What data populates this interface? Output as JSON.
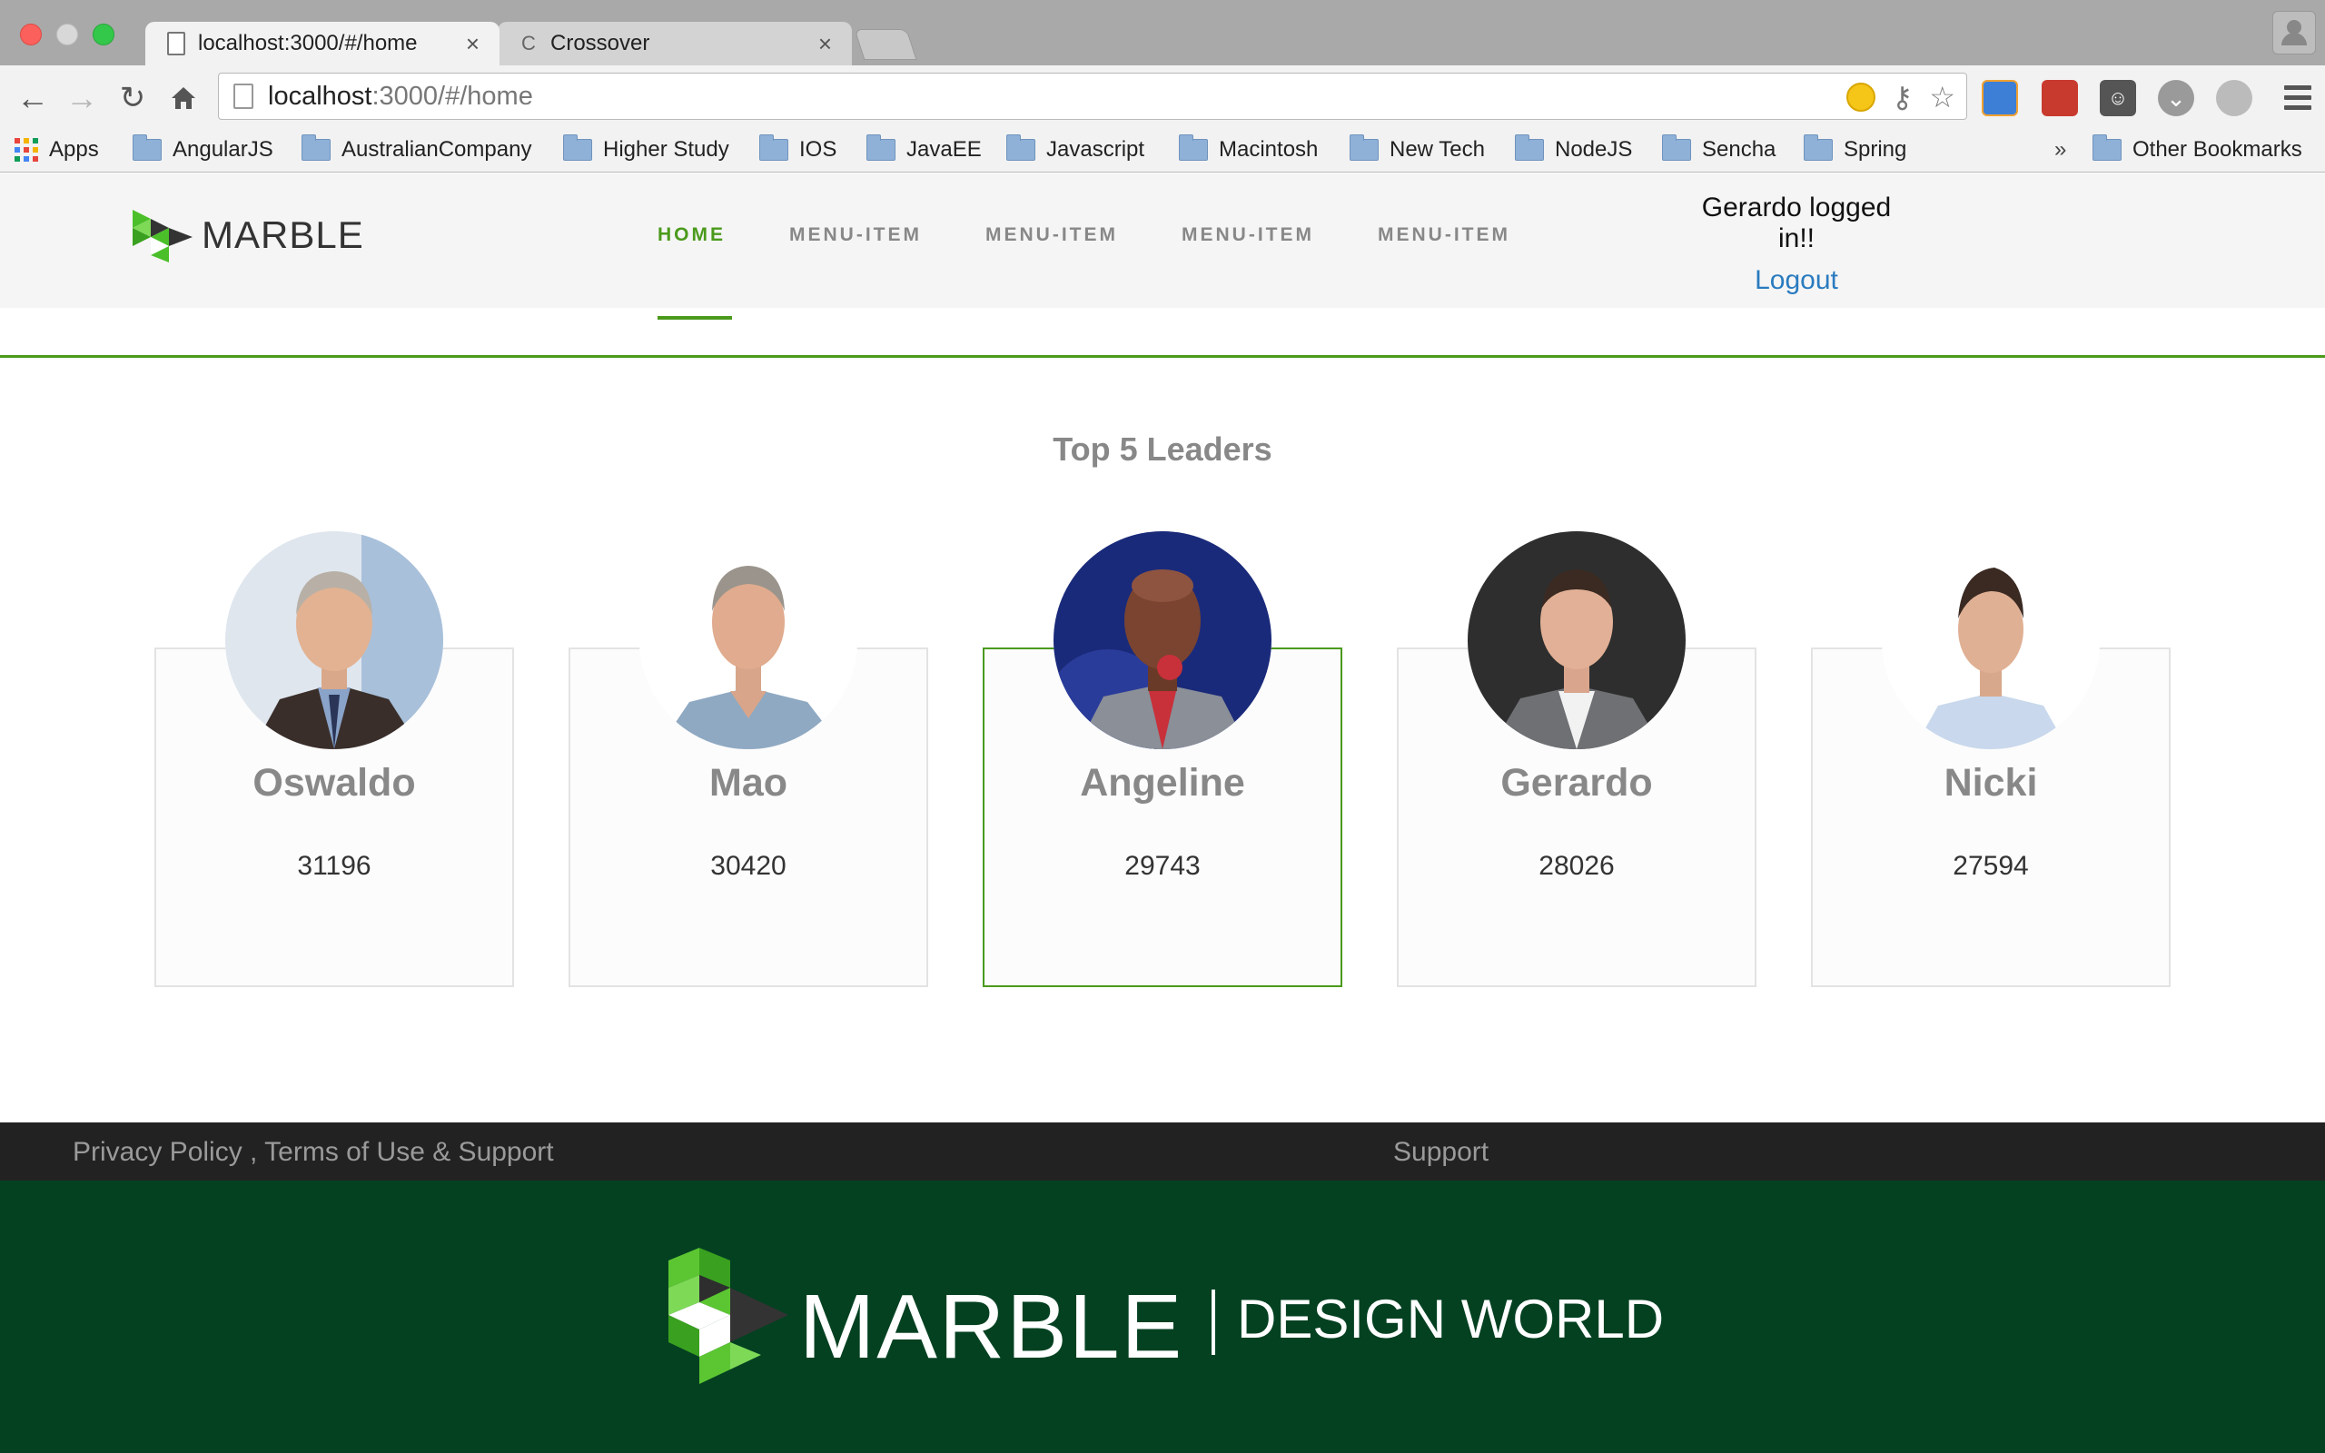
{
  "browser": {
    "tabs": [
      {
        "title": "localhost:3000/#/home",
        "close": "×"
      },
      {
        "title": "Crossover",
        "close": "×"
      }
    ],
    "url": {
      "host": "localhost",
      "path": ":3000/#/home"
    },
    "bookmarks": [
      {
        "label": "Apps",
        "icon": "apps-grid-icon"
      },
      {
        "label": "AngularJS",
        "icon": "folder-icon"
      },
      {
        "label": "AustralianCompany",
        "icon": "folder-icon"
      },
      {
        "label": "Higher Study",
        "icon": "folder-icon"
      },
      {
        "label": "IOS",
        "icon": "folder-icon"
      },
      {
        "label": "JavaEE",
        "icon": "folder-icon"
      },
      {
        "label": "Javascript",
        "icon": "folder-icon"
      },
      {
        "label": "Macintosh",
        "icon": "folder-icon"
      },
      {
        "label": "New Tech",
        "icon": "folder-icon"
      },
      {
        "label": "NodeJS",
        "icon": "folder-icon"
      },
      {
        "label": "Sencha",
        "icon": "folder-icon"
      },
      {
        "label": "Spring",
        "icon": "folder-icon"
      }
    ],
    "more_bookmarks": "»",
    "other_bookmarks": "Other Bookmarks"
  },
  "header": {
    "logo_text": "MARBLE",
    "nav": [
      "HOME",
      "MENU-ITEM",
      "MENU-ITEM",
      "MENU-ITEM",
      "MENU-ITEM"
    ],
    "active_nav": "HOME",
    "user_status": "Gerardo logged in!!",
    "logout": "Logout"
  },
  "leaders": {
    "title": "Top 5 Leaders",
    "items": [
      {
        "name": "Oswaldo",
        "score": "31196",
        "highlighted": false
      },
      {
        "name": "Mao",
        "score": "30420",
        "highlighted": false
      },
      {
        "name": "Angeline",
        "score": "29743",
        "highlighted": true
      },
      {
        "name": "Gerardo",
        "score": "28026",
        "highlighted": false
      },
      {
        "name": "Nicki",
        "score": "27594",
        "highlighted": false
      }
    ]
  },
  "footer": {
    "links": "Privacy Policy , Terms of Use & Support",
    "support": "Support",
    "brand": "MARBLE",
    "tagline": "DESIGN WORLD"
  },
  "colors": {
    "accent": "#4b9a1c",
    "footer_brand_bg": "#034121",
    "footer_bar_bg": "#222222",
    "link": "#2a7bbf"
  }
}
